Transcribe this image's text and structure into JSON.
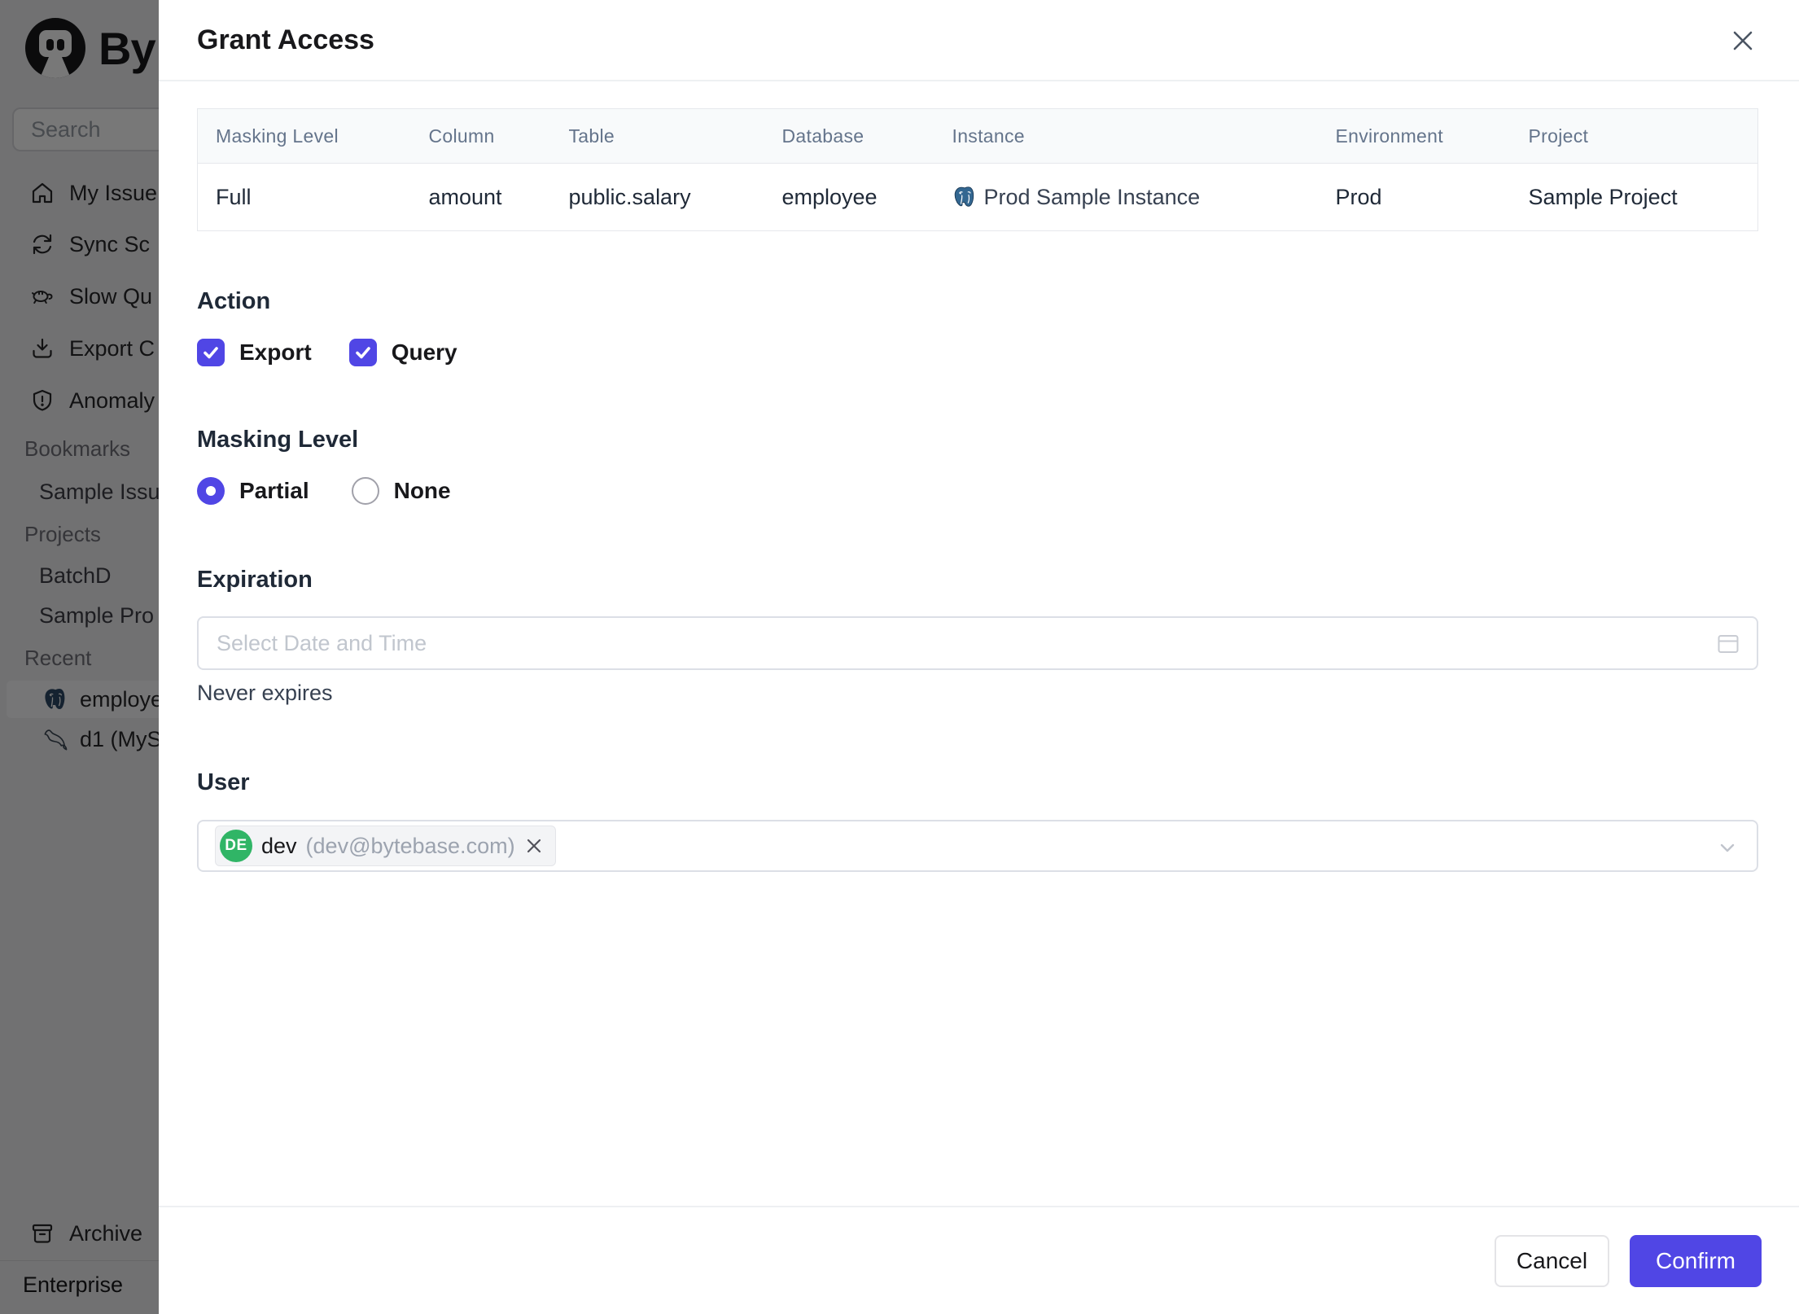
{
  "colors": {
    "accent": "#5046e5",
    "avatar_green": "#30b566"
  },
  "sidebar": {
    "logo_text": "By",
    "search_placeholder": "Search",
    "nav_items": [
      {
        "icon": "home-icon",
        "label": "My Issue"
      },
      {
        "icon": "sync-icon",
        "label": "Sync Sc"
      },
      {
        "icon": "turtle-icon",
        "label": "Slow Qu"
      },
      {
        "icon": "download-icon",
        "label": "Export C"
      },
      {
        "icon": "shield-icon",
        "label": "Anomaly"
      }
    ],
    "bookmarks_section": {
      "label": "Bookmarks",
      "items": [
        {
          "label": "Sample Issu"
        }
      ]
    },
    "projects_section": {
      "label": "Projects",
      "items": [
        {
          "label": "BatchD"
        },
        {
          "label": "Sample Pro"
        }
      ]
    },
    "recent_section": {
      "label": "Recent",
      "items": [
        {
          "icon": "postgresql-icon",
          "label": "employe",
          "selected": true
        },
        {
          "icon": "mysql-icon",
          "label": "d1 (MyS",
          "selected": false
        }
      ]
    },
    "archive_label": "Archive",
    "enterprise_label": "Enterprise"
  },
  "dialog": {
    "title": "Grant Access",
    "table": {
      "headers": [
        "Masking Level",
        "Column",
        "Table",
        "Database",
        "Instance",
        "Environment",
        "Project"
      ],
      "row": {
        "masking_level": "Full",
        "column": "amount",
        "table": "public.salary",
        "database": "employee",
        "instance": "Prod Sample Instance",
        "instance_icon": "postgresql-icon",
        "environment": "Prod",
        "project": "Sample Project"
      }
    },
    "action": {
      "heading": "Action",
      "checkboxes": [
        {
          "label": "Export",
          "checked": true
        },
        {
          "label": "Query",
          "checked": true
        }
      ]
    },
    "masking": {
      "heading": "Masking Level",
      "radios": [
        {
          "label": "Partial",
          "selected": true
        },
        {
          "label": "None",
          "selected": false
        }
      ]
    },
    "expiration": {
      "heading": "Expiration",
      "placeholder": "Select Date and Time",
      "note": "Never expires"
    },
    "user": {
      "heading": "User",
      "tag": {
        "avatar_initials": "DE",
        "name": "dev",
        "email": "(dev@bytebase.com)"
      }
    },
    "footer": {
      "cancel_label": "Cancel",
      "confirm_label": "Confirm"
    }
  }
}
